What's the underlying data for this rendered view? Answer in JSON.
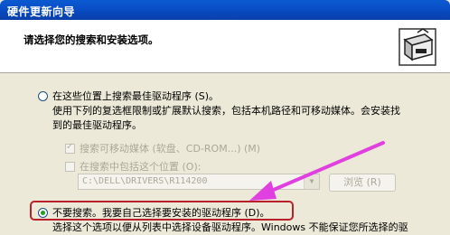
{
  "window": {
    "title": "硬件更新向导"
  },
  "header": {
    "heading": "请选择您的搜索和安装选项。"
  },
  "option_search": {
    "label": "在这些位置上搜索最佳驱动程序 (S)。",
    "desc_line1": "使用下列的复选框限制或扩展默认搜索，包括本机路径和可移动媒体。会安装找",
    "desc_line2": "到的最佳驱动程序。",
    "checked": false
  },
  "checkbox_removable": {
    "label": "搜索可移动媒体 (软盘、CD-ROM...) (M)",
    "checked": true
  },
  "checkbox_location": {
    "label": "在搜索中包括这个位置 (O):",
    "checked": false
  },
  "path_field": {
    "value": "C:\\DELL\\DRIVERS\\R114200"
  },
  "browse_button": {
    "label": "浏览 (R)"
  },
  "option_manual": {
    "label": "不要搜索。我要自己选择要安装的驱动程序 (D)。",
    "checked": true,
    "desc_line1": "选择这个选项以便从列表中选择设备驱动程序。Windows 不能保证您所选择的驱"
  },
  "colors": {
    "titlebar": "#0a4fc8",
    "annotation": "#e040e0",
    "highlight_box": "#b9202a"
  }
}
